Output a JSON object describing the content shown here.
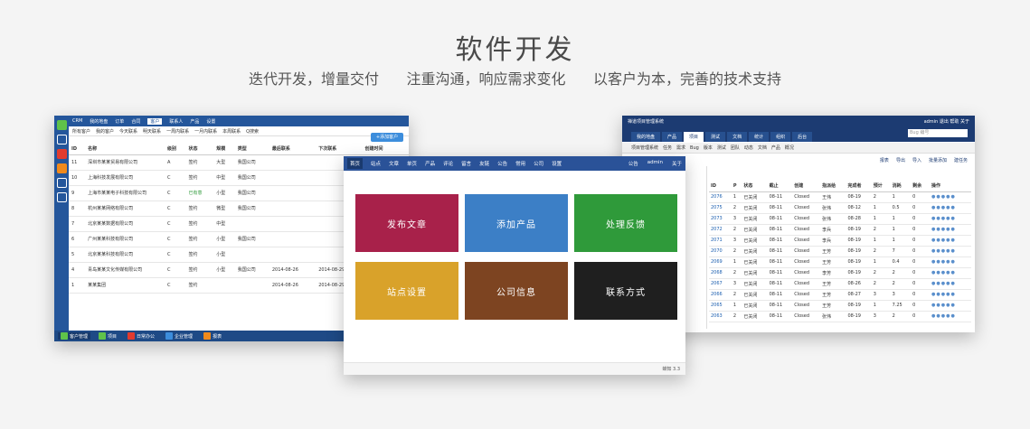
{
  "hero": {
    "title": "软件开发",
    "subtitle": "迭代开发，增量交付      注重沟通，响应需求变化      以客户为本，完善的技术支持"
  },
  "crm": {
    "nav": [
      "CRM",
      "我的地盘",
      "订单",
      "合同",
      "客户",
      "联系人",
      "产品",
      "设置"
    ],
    "active_nav": "客户",
    "subnav": [
      "所有客户",
      "我的客户",
      "今天联系",
      "明天联系",
      "一周内联系",
      "一月内联系",
      "本周联系",
      "Q搜索"
    ],
    "add_button": "+添加客户",
    "columns": [
      "ID",
      "名称",
      "级别",
      "状态",
      "规模",
      "类型",
      "最后联系",
      "下次联系",
      "创建时间"
    ],
    "rows": [
      [
        "11",
        "深圳市某某贸易有限公司",
        "A",
        "签约",
        "大型",
        "我国公司",
        "",
        "",
        "2014-08-26"
      ],
      [
        "10",
        "上海科技发展有限公司",
        "C",
        "签约",
        "中型",
        "我国公司",
        "",
        "",
        "2014-08-26"
      ],
      [
        "9",
        "上海市某某电子科技有限公司",
        "C",
        "已有意",
        "小型",
        "我国公司",
        "",
        "",
        "2014-08-26"
      ],
      [
        "8",
        "杭州某某网络有限公司",
        "C",
        "签约",
        "微型",
        "我国公司",
        "",
        "",
        "2014-08-26"
      ],
      [
        "7",
        "北京某某数据有限公司",
        "C",
        "签约",
        "中型",
        "",
        "",
        "",
        "2014-08-26"
      ],
      [
        "6",
        "广州某某科技有限公司",
        "C",
        "签约",
        "小型",
        "我国公司",
        "",
        "",
        "2014-08-26"
      ],
      [
        "5",
        "北京某某科技有限公司",
        "C",
        "签约",
        "小型",
        "",
        "",
        "",
        "2014-08-26"
      ],
      [
        "4",
        "青岛某某文化传媒有限公司",
        "C",
        "签约",
        "小型",
        "我国公司",
        "2014-08-26",
        "2014-08-29",
        "2014-08-26"
      ],
      [
        "1",
        "某某集团",
        "C",
        "签约",
        "",
        "",
        "2014-08-26",
        "2014-08-29",
        "2014-08-26"
      ]
    ],
    "footer": "共 9 条记录  每页 20 条",
    "tasks": [
      "客户管理",
      "项目",
      "日常办公",
      "企业管理",
      "报表"
    ]
  },
  "proj": {
    "brand": "禅道项目管理系统",
    "user": "admin  退出  帮助  关于",
    "nav": [
      "我的地盘",
      "产品",
      "项目",
      "测试",
      "文档",
      "统计",
      "组织",
      "后台"
    ],
    "active_nav": "项目",
    "search_placeholder": "Bug 编号",
    "subnav": [
      "项目管理系统",
      "任务",
      "需求",
      "Bug",
      "版本",
      "测试",
      "团队",
      "动态",
      "文档",
      "产品",
      "概况"
    ],
    "actions": [
      "报表",
      "导出",
      "导入",
      "批量添加",
      "建任务"
    ],
    "columns": [
      "ID",
      "P",
      "状态",
      "截止",
      "创建",
      "指派给",
      "完成者",
      "预计",
      "消耗",
      "剩余",
      "操作"
    ],
    "rows": [
      [
        "2076",
        "1",
        "已关闭",
        "08-11",
        "Closed",
        "王伟",
        "08-19",
        "2",
        "1",
        "0"
      ],
      [
        "2075",
        "2",
        "已关闭",
        "08-11",
        "Closed",
        "张伟",
        "08-12",
        "1",
        "0.5",
        "0"
      ],
      [
        "2073",
        "3",
        "已关闭",
        "08-11",
        "Closed",
        "张伟",
        "08-28",
        "1",
        "1",
        "0"
      ],
      [
        "2072",
        "2",
        "已关闭",
        "08-11",
        "Closed",
        "李兵",
        "08-19",
        "2",
        "1",
        "0"
      ],
      [
        "2071",
        "3",
        "已关闭",
        "08-11",
        "Closed",
        "李兵",
        "08-19",
        "1",
        "1",
        "0"
      ],
      [
        "2070",
        "2",
        "已关闭",
        "08-11",
        "Closed",
        "王芳",
        "08-19",
        "2",
        "7",
        "0"
      ],
      [
        "2069",
        "1",
        "已关闭",
        "08-11",
        "Closed",
        "王芳",
        "08-19",
        "1",
        "0.4",
        "0"
      ],
      [
        "2068",
        "2",
        "已关闭",
        "08-11",
        "Closed",
        "李芳",
        "08-19",
        "2",
        "2",
        "0"
      ],
      [
        "2067",
        "3",
        "已关闭",
        "08-11",
        "Closed",
        "王芳",
        "08-26",
        "2",
        "2",
        "0"
      ],
      [
        "2066",
        "2",
        "已关闭",
        "08-11",
        "Closed",
        "王芳",
        "08-27",
        "3",
        "3",
        "0"
      ],
      [
        "2065",
        "1",
        "已关闭",
        "08-11",
        "Closed",
        "王芳",
        "08-19",
        "1",
        "7.25",
        "0"
      ],
      [
        "2063",
        "2",
        "已关闭",
        "08-11",
        "Closed",
        "张伟",
        "08-19",
        "3",
        "2",
        "0"
      ]
    ]
  },
  "cms": {
    "nav": [
      "首页",
      "站点",
      "文章",
      "单页",
      "产品",
      "评论",
      "留言",
      "友链",
      "公告",
      "常用",
      "公司",
      "设置"
    ],
    "active_nav": "首页",
    "right": [
      "公告",
      "admin",
      "关于"
    ],
    "tiles": [
      {
        "label": "发布文章",
        "color": "#a8214a"
      },
      {
        "label": "添加产品",
        "color": "#3c7fc6"
      },
      {
        "label": "处理反馈",
        "color": "#2f9a3a"
      },
      {
        "label": "站点设置",
        "color": "#d9a22a"
      },
      {
        "label": "公司信息",
        "color": "#7d4421"
      },
      {
        "label": "联系方式",
        "color": "#1f1f1f"
      }
    ],
    "footer": "蝉知 3.3"
  }
}
